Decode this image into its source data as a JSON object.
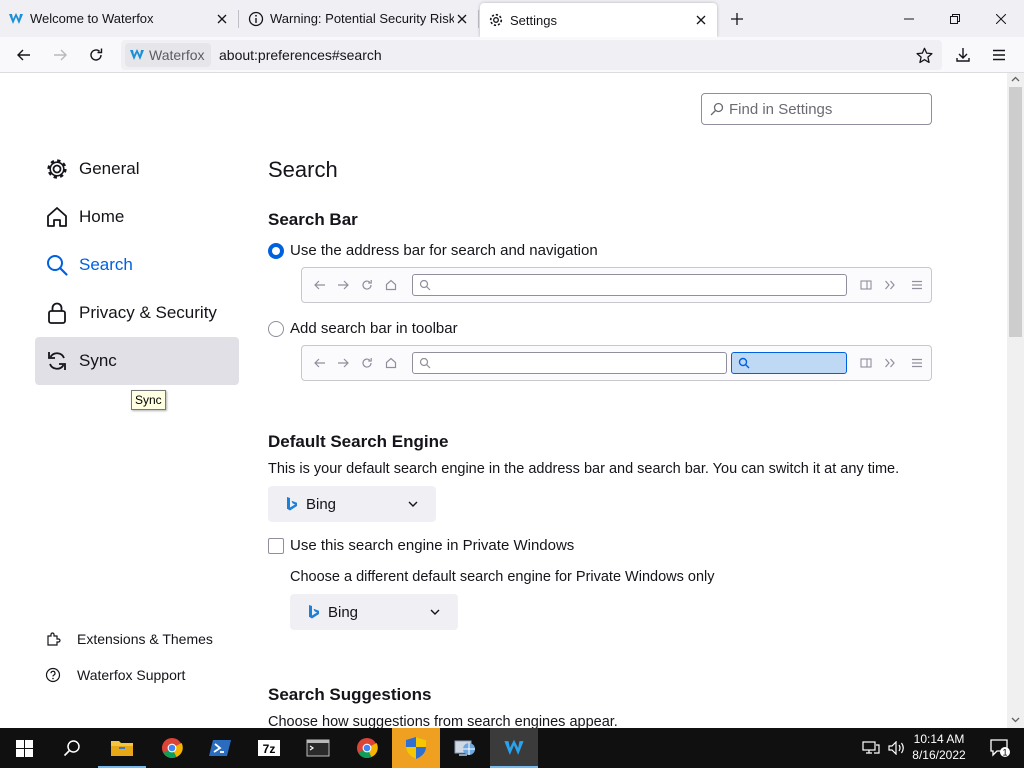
{
  "browser": {
    "tabs": [
      {
        "title": "Welcome to Waterfox"
      },
      {
        "title": "Warning: Potential Security Risk Ah"
      },
      {
        "title": "Settings"
      }
    ],
    "identity_label": "Waterfox",
    "url": "about:preferences#search"
  },
  "sidebar": {
    "categories": [
      {
        "label": "General"
      },
      {
        "label": "Home"
      },
      {
        "label": "Search"
      },
      {
        "label": "Privacy & Security"
      },
      {
        "label": "Sync"
      }
    ],
    "tooltip": "Sync",
    "footer": [
      {
        "label": "Extensions & Themes"
      },
      {
        "label": "Waterfox Support"
      }
    ]
  },
  "find": {
    "placeholder": "Find in Settings"
  },
  "main": {
    "page_title": "Search",
    "search_bar": {
      "heading": "Search Bar",
      "option_address": "Use the address bar for search and navigation",
      "option_toolbar": "Add search bar in toolbar",
      "selected": "address"
    },
    "default_engine": {
      "heading": "Default Search Engine",
      "description": "This is your default search engine in the address bar and search bar. You can switch it at any time.",
      "engine": "Bing",
      "private_checkbox": "Use this search engine in Private Windows",
      "private_checked": false,
      "private_description": "Choose a different default search engine for Private Windows only",
      "private_engine": "Bing"
    },
    "suggestions": {
      "heading": "Search Suggestions",
      "description": "Choose how suggestions from search engines appear."
    }
  },
  "taskbar": {
    "clock_time": "10:14 AM",
    "clock_date": "8/16/2022",
    "notification_count": "1"
  },
  "colors": {
    "accent": "#0061e0",
    "taskbar": "#101010"
  }
}
